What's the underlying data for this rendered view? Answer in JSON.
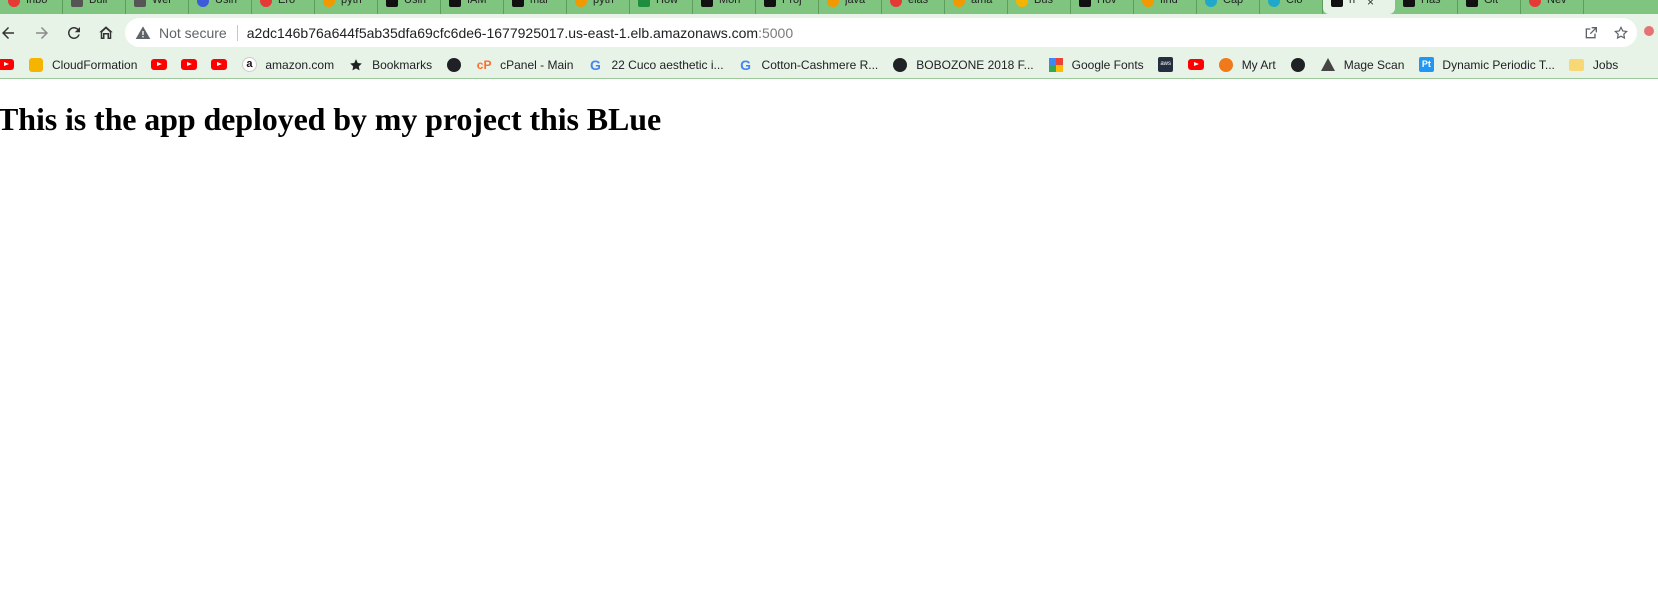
{
  "tabs": [
    {
      "title": "Inbo",
      "icon": "gmail-icon",
      "color": "red"
    },
    {
      "title": "Buil",
      "icon": "jenkins-icon",
      "color": "gray"
    },
    {
      "title": "Wel",
      "icon": "jenkins-icon",
      "color": "gray"
    },
    {
      "title": "Usin",
      "icon": "browser-icon",
      "color": "blue"
    },
    {
      "title": "Ero",
      "icon": "error-icon",
      "color": "red"
    },
    {
      "title": "pyth",
      "icon": "stackoverflow-icon",
      "color": "orange"
    },
    {
      "title": "Usin",
      "icon": "github-icon",
      "color": "black"
    },
    {
      "title": "IAM",
      "icon": "globe-icon",
      "color": "black"
    },
    {
      "title": "mar",
      "icon": "github-icon",
      "color": "black"
    },
    {
      "title": "pyth",
      "icon": "stackoverflow-icon",
      "color": "orange"
    },
    {
      "title": "How",
      "icon": "vsc-icon",
      "color": "green"
    },
    {
      "title": "Mon",
      "icon": "mon-icon",
      "color": "black"
    },
    {
      "title": "Proj",
      "icon": "github-icon",
      "color": "black"
    },
    {
      "title": "java",
      "icon": "stackoverflow-icon",
      "color": "orange"
    },
    {
      "title": "elas",
      "icon": "error-icon",
      "color": "red"
    },
    {
      "title": "ama",
      "icon": "stackoverflow-icon",
      "color": "orange"
    },
    {
      "title": "Bus",
      "icon": "cube-icon",
      "color": "yellow"
    },
    {
      "title": "Hov",
      "icon": "aws-icon",
      "color": "black"
    },
    {
      "title": "find",
      "icon": "stackoverflow-icon",
      "color": "orange"
    },
    {
      "title": "Cap",
      "icon": "cloud-icon",
      "color": "teal"
    },
    {
      "title": "Clo",
      "icon": "cloud-icon",
      "color": "teal"
    },
    {
      "title": "h",
      "icon": "github-icon",
      "color": "black",
      "active": true
    },
    {
      "title": "Has",
      "icon": "github-icon",
      "color": "black"
    },
    {
      "title": "Git",
      "icon": "github-icon",
      "color": "black"
    },
    {
      "title": "Nev",
      "icon": "error-icon",
      "color": "red"
    }
  ],
  "omnibox": {
    "security_label": "Not secure",
    "url_host": "a2dc146b76a644f5ab35dfa69cfc6de6-1677925017.us-east-1.elb.amazonaws.com",
    "url_port": ":5000"
  },
  "bookmarks": [
    {
      "label": "",
      "icon": "youtube"
    },
    {
      "label": "CloudFormation",
      "icon": "cube"
    },
    {
      "label": "",
      "icon": "youtube"
    },
    {
      "label": "",
      "icon": "youtube"
    },
    {
      "label": "",
      "icon": "youtube"
    },
    {
      "label": "amazon.com",
      "icon": "amazon"
    },
    {
      "label": "Bookmarks",
      "icon": "star"
    },
    {
      "label": "",
      "icon": "globe"
    },
    {
      "label": "cPanel - Main",
      "icon": "cpanel"
    },
    {
      "label": "22 Cuco aesthetic i...",
      "icon": "google"
    },
    {
      "label": "Cotton-Cashmere R...",
      "icon": "google"
    },
    {
      "label": "BOBOZONE 2018 F...",
      "icon": "globe"
    },
    {
      "label": "Google Fonts",
      "icon": "google-fonts"
    },
    {
      "label": "",
      "icon": "aws"
    },
    {
      "label": "",
      "icon": "youtube"
    },
    {
      "label": "My Art",
      "icon": "myart"
    },
    {
      "label": "",
      "icon": "globe"
    },
    {
      "label": "Mage Scan",
      "icon": "mage"
    },
    {
      "label": "Dynamic Periodic T...",
      "icon": "pt"
    },
    {
      "label": "Jobs",
      "icon": "folder"
    }
  ],
  "page": {
    "heading": "This is the app deployed by my project this BLue"
  }
}
